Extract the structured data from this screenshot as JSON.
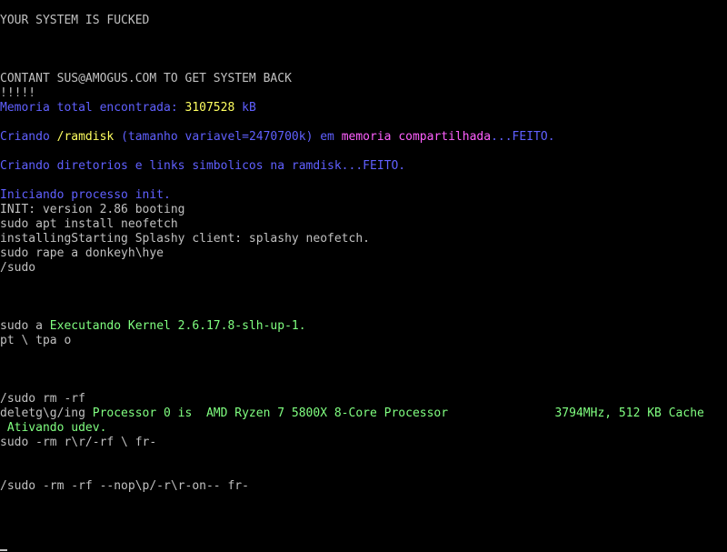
{
  "colors": {
    "background": "#000000",
    "default": "#c0c0c0",
    "blue": "#6060ff",
    "yellow": "#ffff60",
    "magenta": "#ff60ff",
    "green": "#80ff80"
  },
  "lines": [
    [
      {
        "text": "YOUR SYSTEM IS FUCKED",
        "color": "default"
      }
    ],
    [],
    [],
    [],
    [
      {
        "text": "CONTANT SUS@AMOGUS.COM TO GET SYSTEM BACK",
        "color": "default"
      }
    ],
    [
      {
        "text": "!!!!!",
        "color": "default"
      }
    ],
    [
      {
        "text": "Memoria total encontrada: ",
        "color": "blue"
      },
      {
        "text": "3107528",
        "color": "yellow"
      },
      {
        "text": " kB",
        "color": "blue"
      }
    ],
    [],
    [
      {
        "text": "Criando ",
        "color": "blue"
      },
      {
        "text": "/ramdisk",
        "color": "yellow"
      },
      {
        "text": " (tamanho variavel=2470700k) em ",
        "color": "blue"
      },
      {
        "text": "memoria compartilhada",
        "color": "magenta"
      },
      {
        "text": "...FEITO.",
        "color": "blue"
      }
    ],
    [],
    [
      {
        "text": "Criando diretorios e links simbolicos na ramdisk...FEITO.",
        "color": "blue"
      }
    ],
    [],
    [
      {
        "text": "Iniciando processo init.",
        "color": "blue"
      }
    ],
    [
      {
        "text": "INIT: version 2.86 booting",
        "color": "default"
      }
    ],
    [
      {
        "text": "sudo apt install neofetch",
        "color": "default"
      }
    ],
    [
      {
        "text": "installingStarting Splashy client: splashy neofetch.",
        "color": "default"
      }
    ],
    [
      {
        "text": "sudo rape a donkeyh\\hye",
        "color": "default"
      }
    ],
    [
      {
        "text": "/sudo",
        "color": "default"
      }
    ],
    [],
    [],
    [],
    [
      {
        "text": "sudo a ",
        "color": "default"
      },
      {
        "text": "Executando Kernel 2.6.17.8-slh-up-1.",
        "color": "green"
      }
    ],
    [
      {
        "text": "pt \\ tpa o",
        "color": "default"
      }
    ],
    [],
    [],
    [],
    [
      {
        "text": "/sudo rm -rf",
        "color": "default"
      }
    ],
    [
      {
        "text": "deletg\\g/ing ",
        "color": "default"
      },
      {
        "text": "Processor 0 is  AMD Ryzen 7 5800X 8-Core Processor               3794MHz, 512 KB Cache",
        "color": "green"
      }
    ],
    [
      {
        "text": " Ativando udev.",
        "color": "green"
      }
    ],
    [
      {
        "text": "sudo -rm r\\r/-rf \\ fr-",
        "color": "default"
      }
    ],
    [],
    [],
    [
      {
        "text": "/sudo -rm -rf --nop\\p/-r\\r-on-- fr-",
        "color": "default"
      }
    ],
    [],
    [],
    []
  ],
  "cursor": "_"
}
